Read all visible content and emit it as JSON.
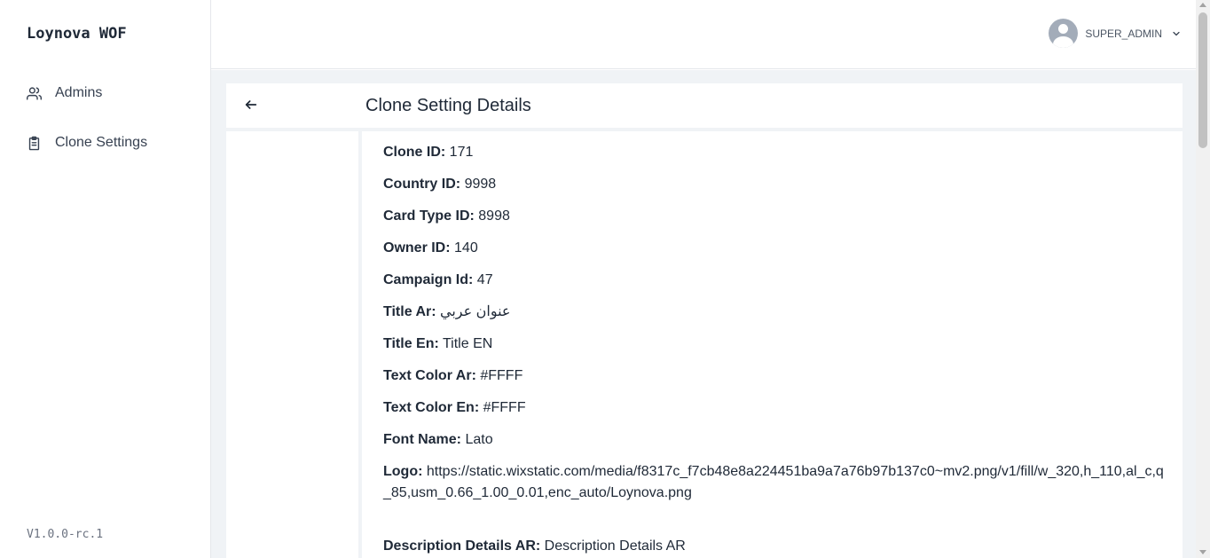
{
  "app": {
    "brand": "Loynova WOF",
    "version": "V1.0.0-rc.1"
  },
  "sidebar": {
    "items": [
      {
        "label": "Admins",
        "icon": "users-icon"
      },
      {
        "label": "Clone Settings",
        "icon": "clipboard-icon"
      }
    ]
  },
  "header": {
    "user_name": "SUPER_ADMIN"
  },
  "page": {
    "title": "Clone Setting Details"
  },
  "details": [
    {
      "label": "Clone ID:",
      "value": "171"
    },
    {
      "label": "Country ID:",
      "value": "9998"
    },
    {
      "label": "Card Type ID:",
      "value": "8998"
    },
    {
      "label": "Owner ID:",
      "value": "140"
    },
    {
      "label": "Campaign Id:",
      "value": "47"
    },
    {
      "label": "Title Ar:",
      "value": "عنوان عربي"
    },
    {
      "label": "Title En:",
      "value": "Title EN"
    },
    {
      "label": "Text Color Ar:",
      "value": "#FFFF"
    },
    {
      "label": "Text Color En:",
      "value": "#FFFF"
    },
    {
      "label": "Font Name:",
      "value": "Lato"
    },
    {
      "label": "Logo:",
      "value": "https://static.wixstatic.com/media/f8317c_f7cb48e8a224451ba9a7a76b97b137c0~mv2.png/v1/fill/w_320,h_110,al_c,q_85,usm_0.66_1.00_0.01,enc_auto/Loynova.png"
    },
    {
      "label": "Description Details AR:",
      "value": "Description Details AR"
    }
  ]
}
